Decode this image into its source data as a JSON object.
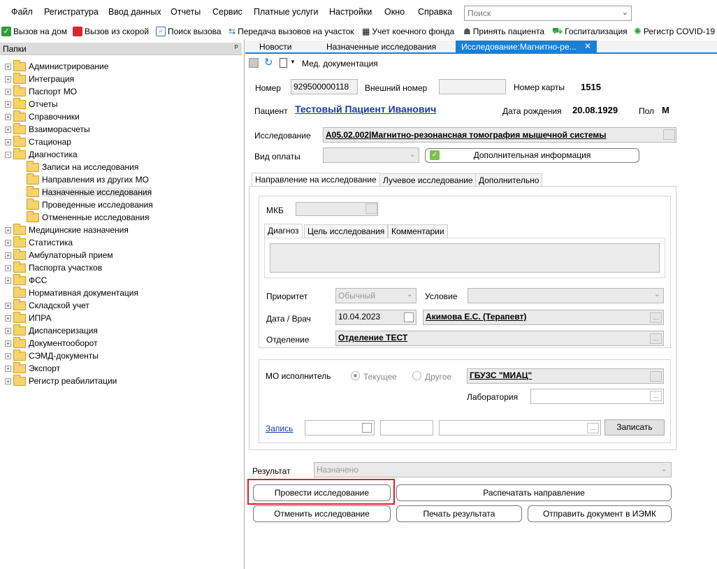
{
  "menu": [
    "Файл",
    "Регистратура",
    "Ввод данных",
    "Отчеты",
    "Сервис",
    "Платные услуги",
    "Настройки",
    "Окно",
    "Справка"
  ],
  "search": {
    "placeholder": "Поиск"
  },
  "toolbar": [
    {
      "label": "Вызов на дом",
      "icon": "house-check-icon",
      "color": "#2e9e3a"
    },
    {
      "label": "Вызов из скорой",
      "icon": "ambulance-icon",
      "color": "#d9272e"
    },
    {
      "label": "Поиск вызова",
      "icon": "search-call-icon",
      "color": "#3a6fb0"
    },
    {
      "label": "Передача вызовов на участок",
      "icon": "transfer-icon",
      "color": "#3a6fb0"
    },
    {
      "label": "Учет коечного фонда",
      "icon": "bed-icon",
      "color": "#333333"
    },
    {
      "label": "Принять пациента",
      "icon": "accept-patient-icon",
      "color": "#555555"
    },
    {
      "label": "Госпитализация",
      "icon": "hospitalization-icon",
      "color": "#2e9e3a"
    },
    {
      "label": "Регистр COVID-19",
      "icon": "virus-icon",
      "color": "#2e9e3a"
    }
  ],
  "folders": {
    "title": "Папки",
    "pin": "ᵖ",
    "items": [
      {
        "label": "Администрирование",
        "level": 0,
        "expander": "+"
      },
      {
        "label": "Интеграция",
        "level": 0,
        "expander": "+"
      },
      {
        "label": "Паспорт МО",
        "level": 0,
        "expander": "+"
      },
      {
        "label": "Отчеты",
        "level": 0,
        "expander": "+"
      },
      {
        "label": "Справочники",
        "level": 0,
        "expander": "+"
      },
      {
        "label": "Взаиморасчеты",
        "level": 0,
        "expander": "+"
      },
      {
        "label": "Стационар",
        "level": 0,
        "expander": "+"
      },
      {
        "label": "Диагностика",
        "level": 0,
        "expander": "−"
      },
      {
        "label": "Записи на исследования",
        "level": 1,
        "expander": ""
      },
      {
        "label": "Направления из других МО",
        "level": 1,
        "expander": ""
      },
      {
        "label": "Назначенные исследования",
        "level": 1,
        "expander": "",
        "selected": true
      },
      {
        "label": "Проведенные исследования",
        "level": 1,
        "expander": ""
      },
      {
        "label": "Отмененные исследования",
        "level": 1,
        "expander": ""
      },
      {
        "label": "Медицинские назначения",
        "level": 0,
        "expander": "+"
      },
      {
        "label": "Статистика",
        "level": 0,
        "expander": "+"
      },
      {
        "label": "Амбулаторный прием",
        "level": 0,
        "expander": "+"
      },
      {
        "label": "Паспорта участков",
        "level": 0,
        "expander": "+"
      },
      {
        "label": "ФСС",
        "level": 0,
        "expander": "+"
      },
      {
        "label": "Нормативная документация",
        "level": 0,
        "expander": ""
      },
      {
        "label": "Складской учет",
        "level": 0,
        "expander": "+"
      },
      {
        "label": "ИПРА",
        "level": 0,
        "expander": "+"
      },
      {
        "label": "Диспансеризация",
        "level": 0,
        "expander": "+"
      },
      {
        "label": "Документооборот",
        "level": 0,
        "expander": "+"
      },
      {
        "label": "СЭМД-документы",
        "level": 0,
        "expander": "+"
      },
      {
        "label": "Экспорт",
        "level": 0,
        "expander": "+"
      },
      {
        "label": "Регистр реабилитации",
        "level": 0,
        "expander": "+"
      }
    ]
  },
  "tabs": [
    "Новости",
    "Назначенные исследования",
    "Исследование:Магнитно-ре..."
  ],
  "tab_close": "✕",
  "doc_toolbar": {
    "label": "Мед. документация"
  },
  "form": {
    "number_label": "Номер",
    "number_value": "929500000118",
    "ext_number_label": "Внешний номер",
    "ext_number_value": "",
    "card_label": "Номер карты",
    "card_value": "1515",
    "patient_label": "Пациент",
    "patient_value": "Тестовый Пациент Иванович",
    "dob_label": "Дата рождения",
    "dob_value": "20.08.1929",
    "sex_label": "Пол",
    "sex_value": "М",
    "study_label": "Исследование",
    "study_value": "А05.02.002|Магнитно-резонансная томография мышечной системы",
    "payment_label": "Вид оплаты",
    "payment_value": "",
    "extra_info_button": "Дополнительная информация"
  },
  "subtabs": [
    "Направление на исследование",
    "Лучевое исследование",
    "Дополнительно"
  ],
  "direction": {
    "mkb_label": "МКБ",
    "mkb_value": "",
    "inner_tabs": [
      "Диагноз",
      "Цель исследования",
      "Комментарии"
    ],
    "diagnosis_text": "",
    "priority_label": "Приоритет",
    "priority_value": "Обычный",
    "condition_label": "Условие",
    "condition_value": "",
    "date_doctor_label": "Дата / Врач",
    "date_value": "10.04.2023",
    "doctor_value": "Акимова Е.С. (Терапевт)",
    "department_label": "Отделение",
    "department_value": "Отделение ТЕСТ"
  },
  "executor": {
    "mo_label": "МО исполнитель",
    "radio_current": "Текущее",
    "radio_other": "Другое",
    "mo_value": "ГБУЗС \"МИАЦ\"",
    "lab_label": "Лаборатория",
    "lab_value": "",
    "record_link": "Запись",
    "record_button": "Записать"
  },
  "result": {
    "label": "Результат",
    "value": "Назначено"
  },
  "actions": {
    "conduct": "Провести исследование",
    "print_direction": "Распечатать направление",
    "cancel": "Отменить исследование",
    "print_result": "Печать результата",
    "send_iemk": "Отправить документ в ИЭМК"
  },
  "colors": {
    "highlight": "#e31e24",
    "active_tab": "#1b7fd4",
    "patient_link": "#1a3aa8"
  }
}
